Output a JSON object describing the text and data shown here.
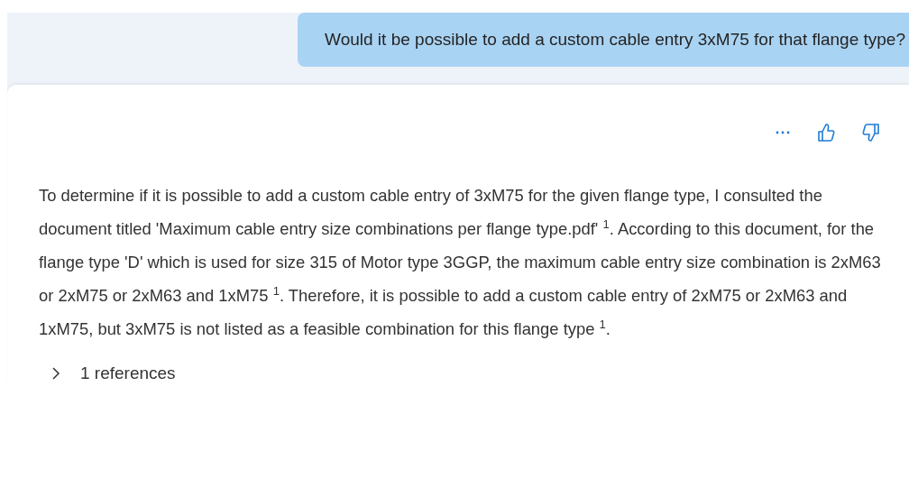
{
  "user_message": {
    "text": "Would it be possible to add a custom cable entry 3xM75 for that flange type?"
  },
  "response": {
    "actions": [
      {
        "kind": "more"
      },
      {
        "kind": "like"
      },
      {
        "kind": "dislike"
      }
    ],
    "text": "To determine if it is possible to add a custom cable entry of 3xM75 for the given flange type, I consulted the document titled 'Maximum cable entry size combinations per flange type.pdf' $^{1}$. According to this document, for the flange type 'D' which is used for size 315 of Motor type 3GGP, the maximum cable entry size combination is 2xM63 or 2xM75 or 2xM63 and 1xM75 $^{1}$. Therefore, it is possible to add a custom cable entry of 2xM75 or 2xM63 and 1xM75, but 3xM75 is not listed as a feasible combination for this flange type $^{1}$.",
    "references": {
      "label": "1 references",
      "expanded": false
    }
  }
}
